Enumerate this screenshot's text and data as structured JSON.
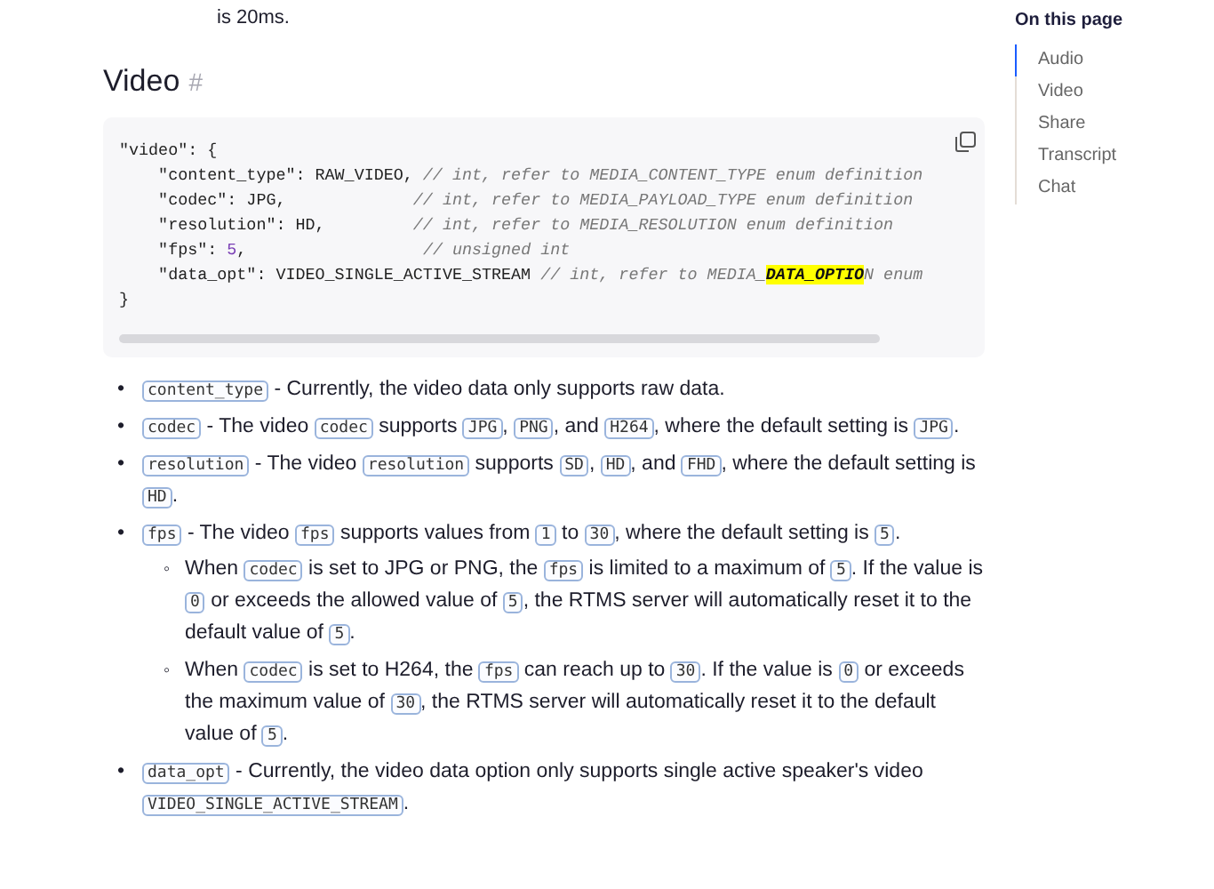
{
  "intro_tail": "is 20ms.",
  "heading": {
    "title": "Video",
    "anchor": "#"
  },
  "code_block": {
    "lines": [
      [
        {
          "kind": "plain",
          "t": "\"video\": {"
        }
      ],
      [
        {
          "kind": "plain",
          "t": "    \"content_type\": RAW_VIDEO, "
        },
        {
          "kind": "comment",
          "t": "// int, refer to MEDIA_CONTENT_TYPE enum definition"
        }
      ],
      [
        {
          "kind": "plain",
          "t": "    \"codec\": JPG,             "
        },
        {
          "kind": "comment",
          "t": "// int, refer to MEDIA_PAYLOAD_TYPE enum definition"
        }
      ],
      [
        {
          "kind": "plain",
          "t": "    \"resolution\": HD,         "
        },
        {
          "kind": "comment",
          "t": "// int, refer to MEDIA_RESOLUTION enum definition"
        }
      ],
      [
        {
          "kind": "plain",
          "t": "    \"fps\": "
        },
        {
          "kind": "number",
          "t": "5"
        },
        {
          "kind": "plain",
          "t": ",                  "
        },
        {
          "kind": "comment",
          "t": "// unsigned int"
        }
      ],
      [
        {
          "kind": "plain",
          "t": "    \"data_opt\": VIDEO_SINGLE_ACTIVE_STREAM "
        },
        {
          "kind": "comment",
          "t": "// int, refer to MEDIA_"
        },
        {
          "kind": "highlight",
          "t": "DATA_OPTIO"
        },
        {
          "kind": "comment",
          "t": "N enum"
        }
      ],
      [
        {
          "kind": "plain",
          "t": "}"
        }
      ]
    ]
  },
  "bullet_marker": "•",
  "sub_marker": "◦",
  "bullets": [
    {
      "segments": [
        {
          "kind": "code",
          "t": "content_type"
        },
        {
          "kind": "text",
          "t": " - Currently, the video data only supports raw data."
        }
      ]
    },
    {
      "segments": [
        {
          "kind": "code",
          "t": "codec"
        },
        {
          "kind": "text",
          "t": " - The video "
        },
        {
          "kind": "code",
          "t": "codec"
        },
        {
          "kind": "text",
          "t": " supports "
        },
        {
          "kind": "code",
          "t": "JPG"
        },
        {
          "kind": "text",
          "t": ", "
        },
        {
          "kind": "code",
          "t": "PNG"
        },
        {
          "kind": "text",
          "t": ", and "
        },
        {
          "kind": "code",
          "t": "H264"
        },
        {
          "kind": "text",
          "t": ", where the default setting is "
        },
        {
          "kind": "code",
          "t": "JPG"
        },
        {
          "kind": "text",
          "t": "."
        }
      ]
    },
    {
      "segments": [
        {
          "kind": "code",
          "t": "resolution"
        },
        {
          "kind": "text",
          "t": " - The video "
        },
        {
          "kind": "code",
          "t": "resolution"
        },
        {
          "kind": "text",
          "t": " supports "
        },
        {
          "kind": "code",
          "t": "SD"
        },
        {
          "kind": "text",
          "t": ", "
        },
        {
          "kind": "code",
          "t": "HD"
        },
        {
          "kind": "text",
          "t": ", and "
        },
        {
          "kind": "code",
          "t": "FHD"
        },
        {
          "kind": "text",
          "t": ", where the default setting is "
        },
        {
          "kind": "code",
          "t": "HD"
        },
        {
          "kind": "text",
          "t": "."
        }
      ]
    },
    {
      "segments": [
        {
          "kind": "code",
          "t": "fps"
        },
        {
          "kind": "text",
          "t": " - The video "
        },
        {
          "kind": "code",
          "t": "fps"
        },
        {
          "kind": "text",
          "t": " supports values from "
        },
        {
          "kind": "code",
          "t": "1"
        },
        {
          "kind": "text",
          "t": " to "
        },
        {
          "kind": "code",
          "t": "30"
        },
        {
          "kind": "text",
          "t": ", where the default setting is "
        },
        {
          "kind": "code",
          "t": "5"
        },
        {
          "kind": "text",
          "t": "."
        }
      ],
      "children": [
        {
          "segments": [
            {
              "kind": "text",
              "t": "When "
            },
            {
              "kind": "code",
              "t": "codec"
            },
            {
              "kind": "text",
              "t": " is set to JPG or PNG, the "
            },
            {
              "kind": "code",
              "t": "fps"
            },
            {
              "kind": "text",
              "t": " is limited to a maximum of "
            },
            {
              "kind": "code",
              "t": "5"
            },
            {
              "kind": "text",
              "t": ". If the value is "
            },
            {
              "kind": "code",
              "t": "0"
            },
            {
              "kind": "text",
              "t": " or exceeds the allowed value of "
            },
            {
              "kind": "code",
              "t": "5"
            },
            {
              "kind": "text",
              "t": ", the RTMS server will automatically reset it to the default value of "
            },
            {
              "kind": "code",
              "t": "5"
            },
            {
              "kind": "text",
              "t": "."
            }
          ]
        },
        {
          "segments": [
            {
              "kind": "text",
              "t": "When "
            },
            {
              "kind": "code",
              "t": "codec"
            },
            {
              "kind": "text",
              "t": " is set to H264, the "
            },
            {
              "kind": "code",
              "t": "fps"
            },
            {
              "kind": "text",
              "t": " can reach up to "
            },
            {
              "kind": "code",
              "t": "30"
            },
            {
              "kind": "text",
              "t": ". If the value is "
            },
            {
              "kind": "code",
              "t": "0"
            },
            {
              "kind": "text",
              "t": " or exceeds the maximum value of "
            },
            {
              "kind": "code",
              "t": "30"
            },
            {
              "kind": "text",
              "t": ", the RTMS server will automatically reset it to the default value of "
            },
            {
              "kind": "code",
              "t": "5"
            },
            {
              "kind": "text",
              "t": "."
            }
          ]
        }
      ]
    },
    {
      "segments": [
        {
          "kind": "code",
          "t": "data_opt"
        },
        {
          "kind": "text",
          "t": " - Currently, the video data option only supports single active speaker's video "
        },
        {
          "kind": "code",
          "t": "VIDEO_SINGLE_ACTIVE_STREAM"
        },
        {
          "kind": "text",
          "t": "."
        }
      ]
    }
  ],
  "toc": {
    "title": "On this page",
    "items": [
      {
        "label": "Audio",
        "selected": true
      },
      {
        "label": "Video",
        "selected": false
      },
      {
        "label": "Share",
        "selected": false
      },
      {
        "label": "Transcript",
        "selected": false
      },
      {
        "label": "Chat",
        "selected": false
      }
    ]
  }
}
